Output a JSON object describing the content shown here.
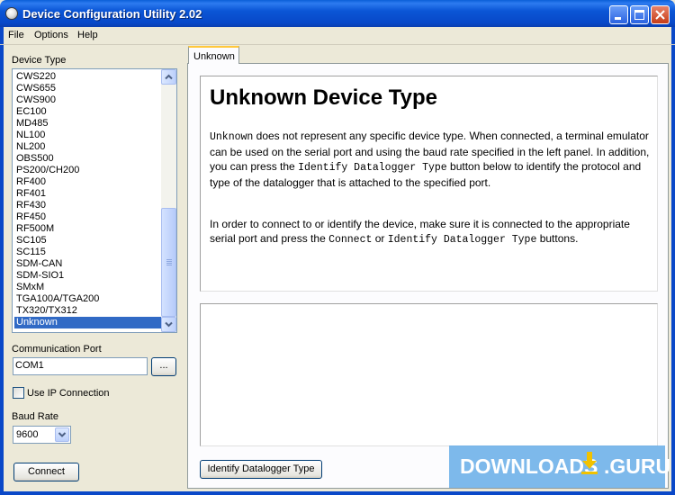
{
  "window": {
    "title": "Device Configuration Utility 2.02",
    "controls": [
      "minimize-icon",
      "maximize-icon",
      "close-icon"
    ],
    "accent_color": "#0a48c8"
  },
  "menu": {
    "file": "File",
    "options": "Options",
    "help": "Help"
  },
  "sidebar": {
    "device_type_label": "Device Type",
    "devices": [
      "CWS220",
      "CWS655",
      "CWS900",
      "EC100",
      "MD485",
      "NL100",
      "NL200",
      "OBS500",
      "PS200/CH200",
      "RF400",
      "RF401",
      "RF430",
      "RF450",
      "RF500M",
      "SC105",
      "SC115",
      "SDM-CAN",
      "SDM-SIO1",
      "SMxM",
      "TGA100A/TGA200",
      "TX320/TX312",
      "Unknown"
    ],
    "selected_device": "Unknown",
    "comm_port_label": "Communication Port",
    "comm_port_value": "COM1",
    "browse_label": "...",
    "use_ip_label": "Use IP Connection",
    "use_ip_checked": false,
    "baud_rate_label": "Baud Rate",
    "baud_rate_value": "9600",
    "connect_label": "Connect"
  },
  "tab": {
    "label": "Unknown"
  },
  "doc": {
    "heading": "Unknown Device Type",
    "p1": {
      "code1": "Unknown",
      "text1": " does not represent any specific device type. When connected, a terminal emulator can be used on the serial port and using the baud rate specified in the left panel. In addition, you can press the ",
      "code2": "Identify Datalogger Type",
      "text2": " button below to identify the protocol and type of the datalogger that is attached to the specified port."
    },
    "p2": {
      "text1": "In order to connect to or identify the device, make sure it is connected to the appropriate serial port and press the ",
      "code1": "Connect",
      "text2": " or ",
      "code2": "Identify Datalogger Type",
      "text3": " buttons."
    }
  },
  "identify_button_label": "Identify Datalogger Type",
  "watermark": {
    "left": "DOWNLOADS",
    "right": ".GURU",
    "arrow_color": "#f2c200"
  }
}
